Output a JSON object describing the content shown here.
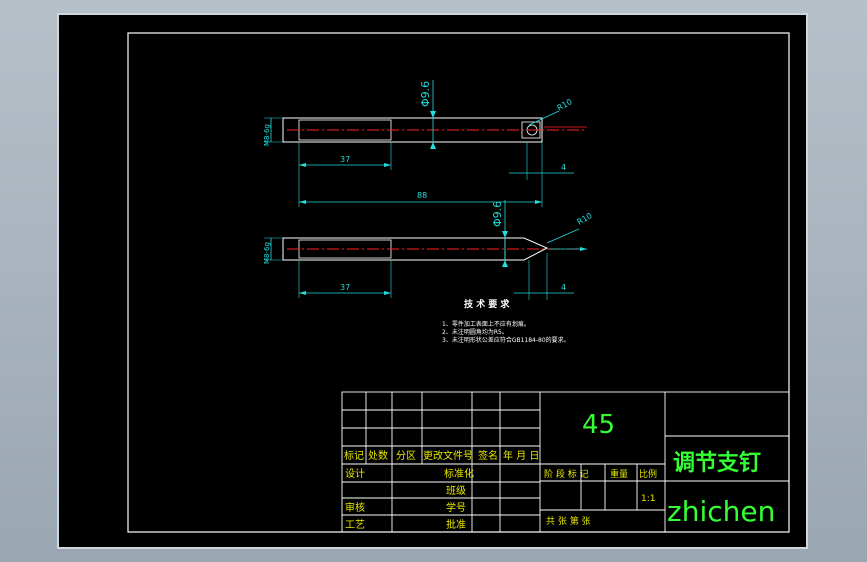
{
  "drawing": {
    "tech_req_title": "技 术 要 求",
    "tech_req_items": [
      "1、零件加工表面上不应有划痕。",
      "2、未注明圆角均为R5。",
      "3、未注明形状公差应符合GB1184-80的要求。"
    ],
    "dims": {
      "view1_dia_vertical": "Φ9.6",
      "view1_radius": "R10",
      "view1_len_37": "37",
      "view1_len_4": "4",
      "view1_total": "88",
      "view1_left_dia": "M8-6g",
      "view2_dia_vertical": "Φ9.6",
      "view2_radius": "R10",
      "view2_len_37": "37",
      "view2_len_4": "4",
      "view2_left_dia": "M8-6g"
    }
  },
  "title_block": {
    "material": "45",
    "part_name": "调节支钉",
    "company": "zhichen",
    "scale": "1:1",
    "row_labels": {
      "biaoji": "标记",
      "chushu": "处数",
      "fenqu": "分区",
      "gengai": "更改文件号",
      "qianming": "签名",
      "nianyueri": "年 月 日"
    },
    "sheji": "设计",
    "biaozhunhua": "标准化",
    "shenhe": "审核",
    "gongyi": "工艺",
    "pizhun_row": "批准",
    "xuehao": "学号",
    "banji": "班级",
    "jieduan": "阶 段 标 记",
    "zhongliang": "重量",
    "bili": "比例",
    "gong_zhang": "共   张   第 张"
  },
  "colors": {
    "geometry": "#ffffff",
    "dimension": "#22dddd",
    "centerline": "#ff2222",
    "text": "#33ff33",
    "frame": "#ffffff"
  }
}
